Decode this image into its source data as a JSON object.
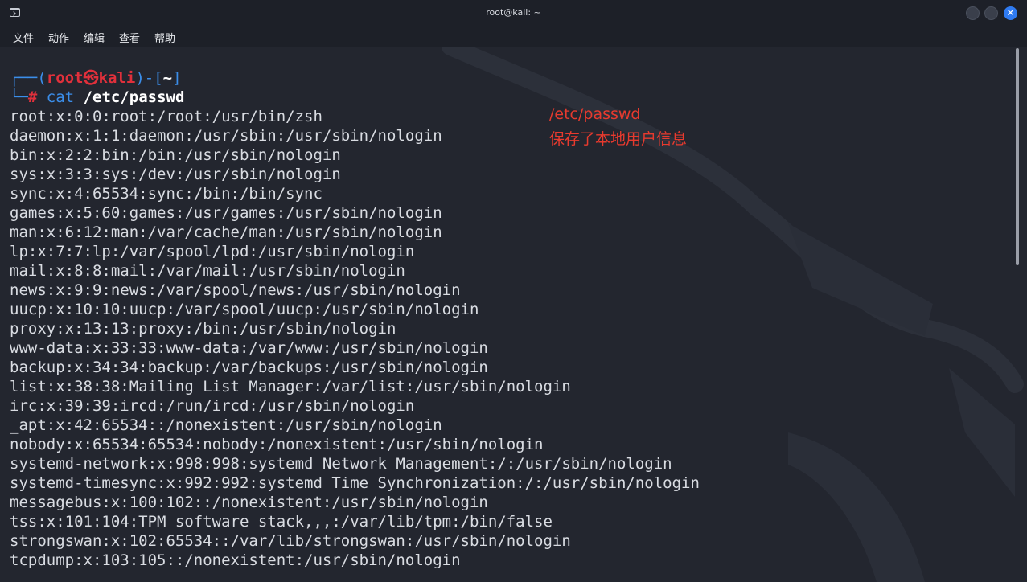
{
  "window": {
    "title": "root@kali: ~"
  },
  "menu": [
    "文件",
    "动作",
    "编辑",
    "查看",
    "帮助"
  ],
  "prompt": {
    "corner_top": "┌──(",
    "user": "root",
    "skull": "㉿",
    "host": "kali",
    "mid": ")-[",
    "dir": "~",
    "end": "]",
    "corner_bottom": "└─",
    "hash": "#",
    "command": "cat",
    "argument": "/etc/passwd"
  },
  "output": [
    "root:x:0:0:root:/root:/usr/bin/zsh",
    "daemon:x:1:1:daemon:/usr/sbin:/usr/sbin/nologin",
    "bin:x:2:2:bin:/bin:/usr/sbin/nologin",
    "sys:x:3:3:sys:/dev:/usr/sbin/nologin",
    "sync:x:4:65534:sync:/bin:/bin/sync",
    "games:x:5:60:games:/usr/games:/usr/sbin/nologin",
    "man:x:6:12:man:/var/cache/man:/usr/sbin/nologin",
    "lp:x:7:7:lp:/var/spool/lpd:/usr/sbin/nologin",
    "mail:x:8:8:mail:/var/mail:/usr/sbin/nologin",
    "news:x:9:9:news:/var/spool/news:/usr/sbin/nologin",
    "uucp:x:10:10:uucp:/var/spool/uucp:/usr/sbin/nologin",
    "proxy:x:13:13:proxy:/bin:/usr/sbin/nologin",
    "www-data:x:33:33:www-data:/var/www:/usr/sbin/nologin",
    "backup:x:34:34:backup:/var/backups:/usr/sbin/nologin",
    "list:x:38:38:Mailing List Manager:/var/list:/usr/sbin/nologin",
    "irc:x:39:39:ircd:/run/ircd:/usr/sbin/nologin",
    "_apt:x:42:65534::/nonexistent:/usr/sbin/nologin",
    "nobody:x:65534:65534:nobody:/nonexistent:/usr/sbin/nologin",
    "systemd-network:x:998:998:systemd Network Management:/:/usr/sbin/nologin",
    "systemd-timesync:x:992:992:systemd Time Synchronization:/:/usr/sbin/nologin",
    "messagebus:x:100:102::/nonexistent:/usr/sbin/nologin",
    "tss:x:101:104:TPM software stack,,,:/var/lib/tpm:/bin/false",
    "strongswan:x:102:65534::/var/lib/strongswan:/usr/sbin/nologin",
    "tcpdump:x:103:105::/nonexistent:/usr/sbin/nologin"
  ],
  "annotation": {
    "line1": "/etc/passwd",
    "line2": "保存了本地用户信息"
  },
  "colors": {
    "prompt_frame": "#3b8eea",
    "prompt_user_host": "#e0303b",
    "annotation": "#e83a2e",
    "close_button": "#2f7bf2"
  },
  "icons": {
    "app": "terminal-icon",
    "minimize": "minimize-icon",
    "maximize": "maximize-icon",
    "close": "close-icon"
  }
}
